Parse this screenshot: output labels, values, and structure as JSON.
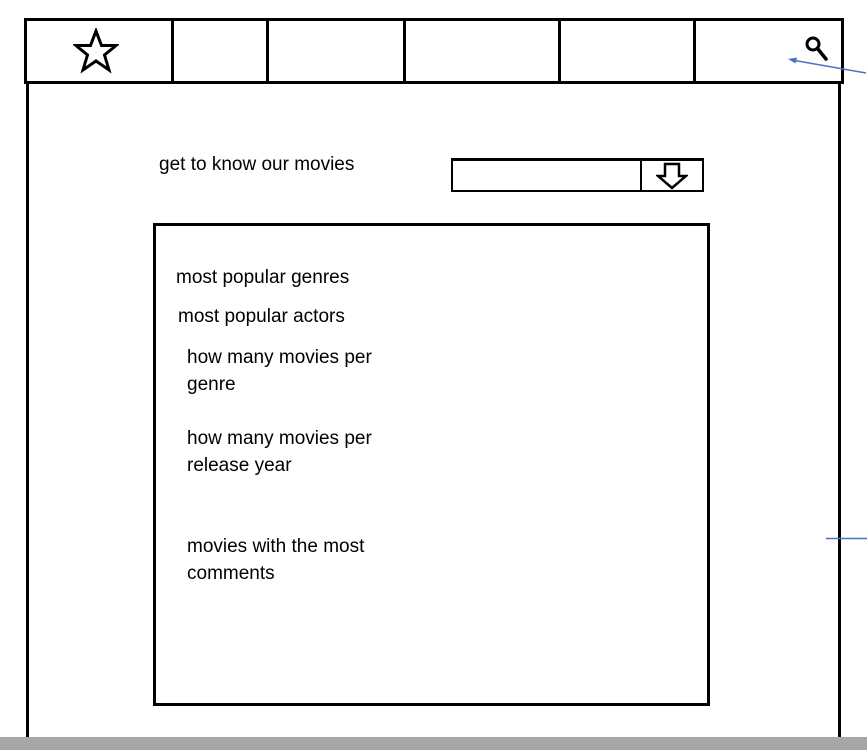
{
  "navbar": {
    "home_icon": "star-icon",
    "search_icon": "search-icon"
  },
  "intro": {
    "label": "get to know our movies",
    "dropdown_value": "",
    "dropdown_icon": "arrow-down-icon"
  },
  "menu": {
    "items": [
      {
        "lines": [
          "most popular genres"
        ]
      },
      {
        "lines": [
          "most popular actors"
        ]
      },
      {
        "lines": [
          "how many movies per",
          "genre"
        ]
      },
      {
        "lines": [
          "how many movies per",
          "release year"
        ]
      },
      {
        "lines": [
          "movies with the most",
          "comments"
        ]
      }
    ]
  },
  "colors": {
    "stroke": "#000000",
    "annotation": "#4a72c4",
    "bottom_bar": "#a6a6a6"
  }
}
